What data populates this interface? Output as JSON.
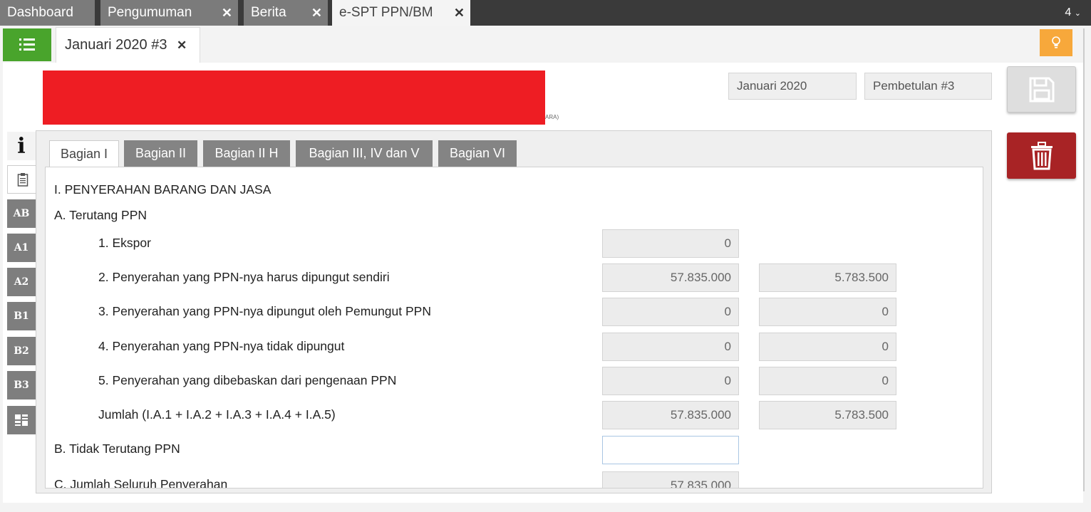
{
  "top_tabs": [
    {
      "label": "Dashboard",
      "closable": false
    },
    {
      "label": "Pengumuman",
      "closable": true
    },
    {
      "label": "Berita",
      "closable": true
    },
    {
      "label": "e-SPT PPN/BM",
      "closable": true,
      "active": true
    }
  ],
  "tab_count": "4",
  "doc_tab": {
    "label": "Januari 2020 #3"
  },
  "header": {
    "period": "Januari 2020",
    "revision": "Pembetulan #3",
    "redacted_tail": "ARA)"
  },
  "side_tabs": [
    {
      "label": "i",
      "icon": "info-icon"
    },
    {
      "label": "",
      "icon": "clipboard-icon"
    },
    {
      "label": "AB"
    },
    {
      "label": "A1"
    },
    {
      "label": "A2"
    },
    {
      "label": "B1"
    },
    {
      "label": "B2"
    },
    {
      "label": "B3"
    },
    {
      "label": "",
      "icon": "grid-icon"
    }
  ],
  "panel_tabs": [
    {
      "label": "Bagian I",
      "active": true
    },
    {
      "label": "Bagian II"
    },
    {
      "label": "Bagian II H"
    },
    {
      "label": "Bagian III, IV dan V"
    },
    {
      "label": "Bagian VI"
    }
  ],
  "section": {
    "title": "I. PENYERAHAN BARANG DAN JASA",
    "a_title": "A. Terutang PPN",
    "rows": [
      {
        "label": "1. Ekspor",
        "dpp": "0",
        "ppn": ""
      },
      {
        "label": "2. Penyerahan yang PPN-nya harus dipungut sendiri",
        "dpp": "57.835.000",
        "ppn": "5.783.500"
      },
      {
        "label": "3. Penyerahan yang PPN-nya dipungut oleh Pemungut PPN",
        "dpp": "0",
        "ppn": "0"
      },
      {
        "label": "4. Penyerahan yang PPN-nya tidak dipungut",
        "dpp": "0",
        "ppn": "0"
      },
      {
        "label": "5. Penyerahan yang dibebaskan dari pengenaan PPN",
        "dpp": "0",
        "ppn": "0"
      },
      {
        "label": "Jumlah (I.A.1 + I.A.2 + I.A.3 + I.A.4 + I.A.5)",
        "dpp": "57.835.000",
        "ppn": "5.783.500"
      }
    ],
    "b_title": "B. Tidak Terutang PPN",
    "b_value": "",
    "c_title": "C. Jumlah Seluruh Penyerahan",
    "c_value": "57.835.000"
  },
  "colors": {
    "menu": "#49a42c",
    "bulb": "#f7a83b",
    "delete": "#a82325",
    "redaction": "#ee1d23"
  }
}
